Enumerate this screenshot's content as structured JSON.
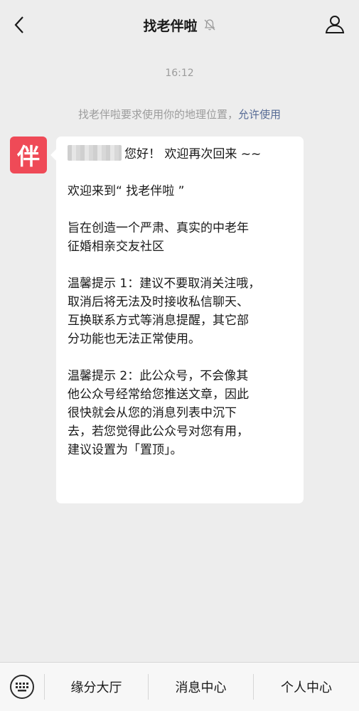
{
  "header": {
    "title": "找老伴啦",
    "back_icon": "chevron-left-icon",
    "mute_icon": "bell-muted-icon",
    "profile_icon": "person-icon"
  },
  "chat": {
    "timestamp": "16:12",
    "location_notice": "找老伴啦要求使用你的地理位置，",
    "location_allow": "允许使用",
    "avatar_char": "伴",
    "avatar_color": "#ef4a57",
    "message": {
      "greeting": "您好！ 欢迎再次回来 ~~",
      "welcome": "欢迎来到“ 找老伴啦 ”",
      "intro": [
        "旨在创造一个严肃、真实的中老年",
        "征婚相亲交友社区"
      ],
      "tip1": [
        "温馨提示 1：建议不要取消关注哦，",
        "取消后将无法及时接收私信聊天、",
        "互换联系方式等消息提醒，其它部",
        "分功能也无法正常使用。"
      ],
      "tip2": [
        "温馨提示 2：此公众号，不会像其",
        "他公众号经常给您推送文章，因此",
        "很快就会从您的消息列表中沉下",
        "去，若您觉得此公众号对您有用，",
        "建议设置为「置顶」。"
      ]
    }
  },
  "bottom_menu": {
    "keyboard_icon": "keyboard-icon",
    "items": [
      "缘分大厅",
      "消息中心",
      "个人中心"
    ]
  }
}
